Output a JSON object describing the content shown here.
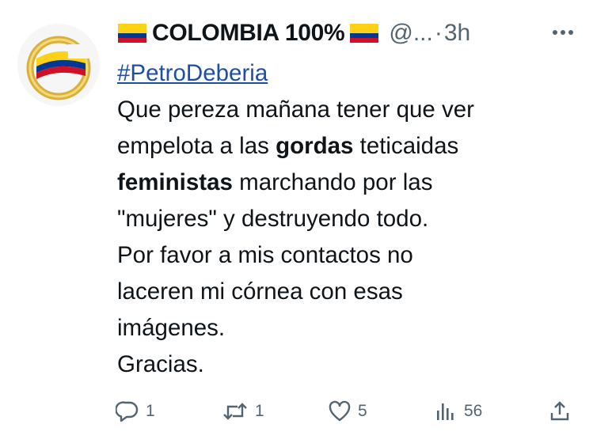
{
  "author": {
    "display_name": "COLOMBIA 100%",
    "handle": "@...",
    "separator": "·",
    "time": "3h",
    "flag_icon": "colombia-flag-icon",
    "avatar_icon": "colombia-logo-avatar"
  },
  "tweet": {
    "hashtag": "#PetroDeberia",
    "lines": [
      {
        "parts": [
          "Que pereza mañana tener que ver"
        ]
      },
      {
        "before": "empelota a las ",
        "bold": "gordas",
        "after": " teticaidas"
      },
      {
        "bold": "feministas",
        "after": " marchando por las"
      },
      {
        "parts": [
          "\"mujeres\" y destruyendo todo."
        ]
      },
      {
        "parts": [
          "Por favor a mis contactos no"
        ]
      },
      {
        "parts": [
          "laceren mi córnea con esas"
        ]
      },
      {
        "parts": [
          "imágenes."
        ]
      },
      {
        "parts": [
          "Gracias."
        ]
      }
    ]
  },
  "actions": {
    "replies": "1",
    "retweets": "1",
    "likes": "5",
    "views": "56"
  },
  "colors": {
    "text": "#0f1419",
    "secondary": "#536471",
    "hashtag": "#1d4fa8",
    "flag_yellow": "#FCD116",
    "flag_blue": "#003893",
    "flag_red": "#CE1126"
  }
}
